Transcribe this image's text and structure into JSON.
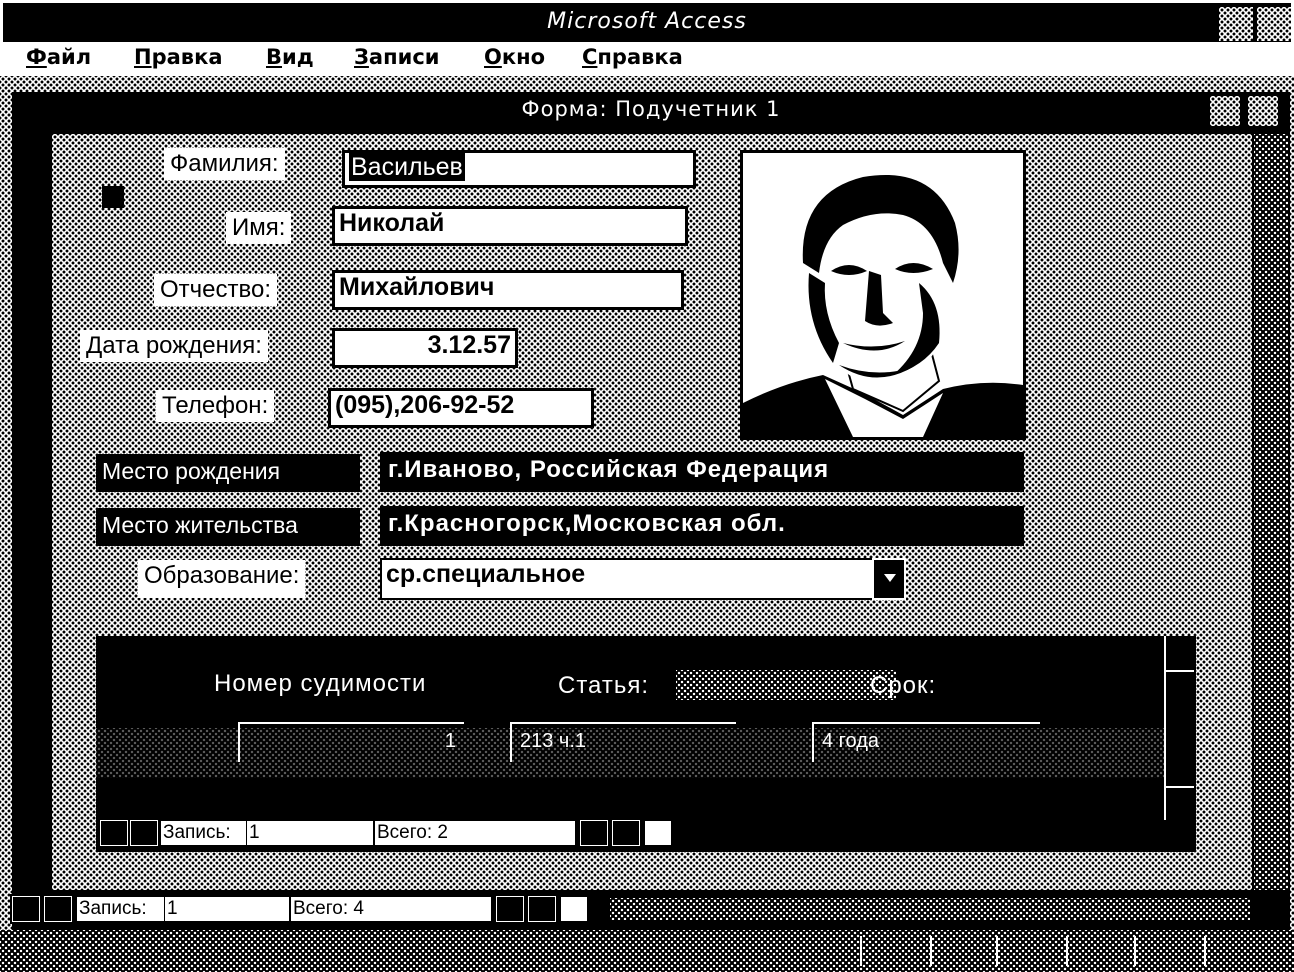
{
  "app": {
    "title": "Microsoft Access"
  },
  "menu": [
    {
      "label": "Файл",
      "key": "Ф",
      "rest": "айл"
    },
    {
      "label": "Правка",
      "key": "П",
      "rest": "равка"
    },
    {
      "label": "Вид",
      "key": "В",
      "rest": "ид"
    },
    {
      "label": "Записи",
      "key": "З",
      "rest": "аписи"
    },
    {
      "label": "Окно",
      "key": "О",
      "rest": "кно"
    },
    {
      "label": "Справка",
      "key": "С",
      "rest": "правка"
    }
  ],
  "form": {
    "title": "Форма: Подучетник  1",
    "fields": {
      "surname": {
        "label": "Фамилия:",
        "value": "Васильев"
      },
      "name": {
        "label": "Имя:",
        "value": "Николай"
      },
      "patronymic": {
        "label": "Отчество:",
        "value": "Михайлович"
      },
      "birthdate": {
        "label": "Дата рождения:",
        "value": "3.12.57"
      },
      "phone": {
        "label": "Телефон:",
        "value": "(095),206-92-52"
      },
      "birthplace": {
        "label": "Место рождения",
        "value": "г.Иваново, Российская Федерация"
      },
      "residence": {
        "label": "Место жительства",
        "value": "г.Красногорск,Московская обл."
      },
      "education": {
        "label": "Образование:",
        "value": "ср.специальное"
      }
    },
    "photo": {
      "icon": "person-photo"
    }
  },
  "subform": {
    "headers": {
      "number": "Номер судимости",
      "article": "Статья:",
      "term": "Срок:"
    },
    "row": {
      "number": "1",
      "article": "213 ч.1",
      "term": "4 года"
    },
    "nav": {
      "record_label": "Запись:",
      "record_value": "1",
      "total_label": "Всего: 2"
    }
  },
  "main_nav": {
    "record_label": "Запись:",
    "record_value": "1",
    "total_label": "Всего: 4"
  }
}
